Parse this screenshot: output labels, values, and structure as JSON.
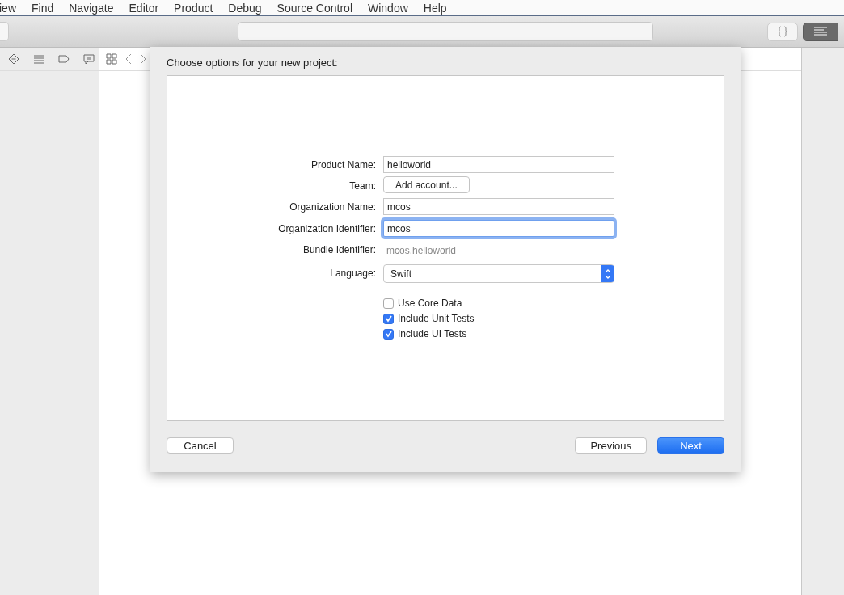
{
  "menu_bar": {
    "items": [
      "iew",
      "Find",
      "Navigate",
      "Editor",
      "Product",
      "Debug",
      "Source Control",
      "Window",
      "Help"
    ]
  },
  "toolbar": {
    "editor_modes": [
      {
        "kind": "braces",
        "selected": false
      },
      {
        "kind": "lines",
        "selected": true
      }
    ]
  },
  "sheet": {
    "title": "Choose options for your new project:",
    "fields": [
      {
        "label": "Product Name:",
        "kind": "text",
        "value": "helloworld",
        "focused": false
      },
      {
        "label": "Team:",
        "kind": "button",
        "value": "Add account..."
      },
      {
        "label": "Organization Name:",
        "kind": "text",
        "value": "mcos",
        "focused": false
      },
      {
        "label": "Organization Identifier:",
        "kind": "text",
        "value": "mcos",
        "focused": true
      },
      {
        "label": "Bundle Identifier:",
        "kind": "static",
        "value": "mcos.helloworld"
      },
      {
        "label": "Language:",
        "kind": "popup",
        "value": "Swift"
      }
    ],
    "options": [
      {
        "label": "Use Core Data",
        "checked": false
      },
      {
        "label": "Include Unit Tests",
        "checked": true
      },
      {
        "label": "Include UI Tests",
        "checked": true
      }
    ],
    "left_buttons": [
      {
        "label": "Cancel",
        "default": false
      }
    ],
    "right_buttons": [
      {
        "label": "Previous",
        "default": false
      },
      {
        "label": "Next",
        "default": true
      }
    ]
  }
}
